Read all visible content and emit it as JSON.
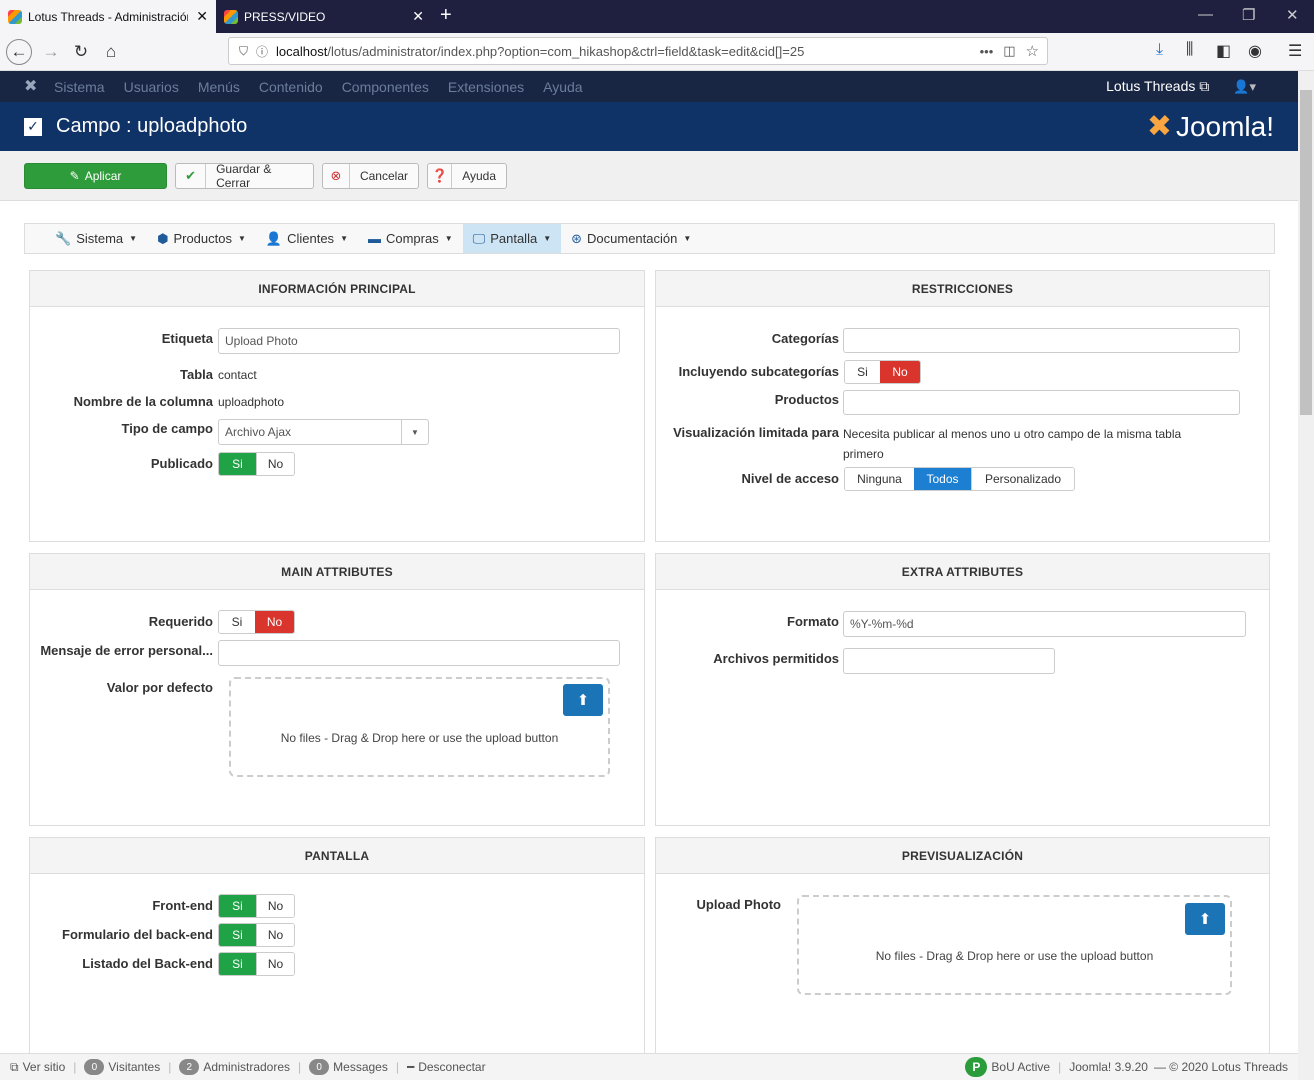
{
  "browser": {
    "tabs": [
      {
        "label": "Lotus Threads - Administración"
      },
      {
        "label": "PRESS/VIDEO"
      }
    ],
    "url_host": "localhost",
    "url_path": "/lotus/administrator/index.php?option=com_hikashop&ctrl=field&task=edit&cid[]=25",
    "new_tab": "+"
  },
  "joomla": {
    "menu": [
      "Sistema",
      "Usuarios",
      "Menús",
      "Contenido",
      "Componentes",
      "Extensiones",
      "Ayuda"
    ],
    "site_name": "Lotus Threads",
    "page_title": "Campo : uploadphoto",
    "brand": "Joomla!"
  },
  "toolbar": {
    "apply": "Aplicar",
    "save_close": "Guardar & Cerrar",
    "cancel": "Cancelar",
    "help": "Ayuda"
  },
  "hikamenu": [
    "Sistema",
    "Productos",
    "Clientes",
    "Compras",
    "Pantalla",
    "Documentación"
  ],
  "info": {
    "title": "INFORMACIÓN PRINCIPAL",
    "label_lbl": "Etiqueta",
    "label_val": "Upload Photo",
    "table_lbl": "Tabla",
    "table_val": "contact",
    "column_lbl": "Nombre de la columna",
    "column_val": "uploadphoto",
    "type_lbl": "Tipo de campo",
    "type_val": "Archivo Ajax",
    "published_lbl": "Publicado"
  },
  "restr": {
    "title": "RESTRICCIONES",
    "categories_lbl": "Categorías",
    "subcat_lbl": "Incluyendo subcategorías",
    "products_lbl": "Productos",
    "limited_lbl": "Visualización limitada para",
    "limited_val": "Necesita publicar al menos uno u otro campo de la misma tabla primero",
    "access_lbl": "Nivel de acceso",
    "access_opts": [
      "Ninguna",
      "Todos",
      "Personalizado"
    ]
  },
  "yes": "Si",
  "no": "No",
  "main": {
    "title": "MAIN ATTRIBUTES",
    "required_lbl": "Requerido",
    "errmsg_lbl": "Mensaje de error personal...",
    "default_lbl": "Valor por defecto",
    "drop_text": "No files - Drag & Drop here or use the upload button"
  },
  "extra": {
    "title": "EXTRA ATTRIBUTES",
    "format_lbl": "Formato",
    "format_val": "%Y-%m-%d",
    "allowed_lbl": "Archivos permitidos"
  },
  "display": {
    "title": "PANTALLA",
    "front_lbl": "Front-end",
    "backform_lbl": "Formulario del back-end",
    "backlist_lbl": "Listado del Back-end"
  },
  "preview": {
    "title": "PREVISUALIZACIÓN",
    "field_lbl": "Upload Photo",
    "drop_text": "No files - Drag & Drop here or use the upload button"
  },
  "status": {
    "view_site": "Ver sitio",
    "visitors_count": "0",
    "visitors": "Visitantes",
    "admins_count": "2",
    "admins": "Administradores",
    "messages_count": "0",
    "messages": "Messages",
    "logout": "Desconectar",
    "bou": "BoU Active",
    "version": "Joomla! 3.9.20",
    "copyright": "— © 2020 Lotus Threads"
  }
}
